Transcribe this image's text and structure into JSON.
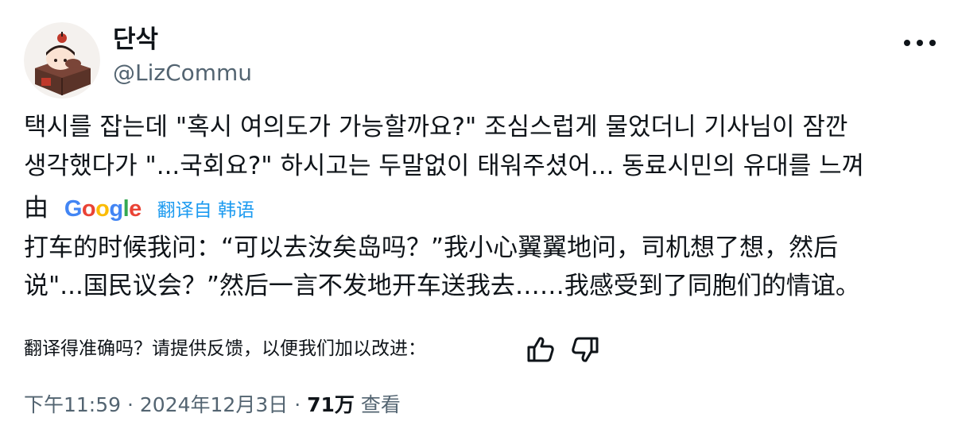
{
  "author": {
    "display_name": "단삭",
    "handle": "@LizCommu"
  },
  "tweet": {
    "text": "택시를 잡는데 \"혹시 여의도가 가능할까요?\" 조심스럽게 물었더니 기사님이 잠깐\n생각했다가 \"...국회요?\" 하시고는 두말없이 태워주셨어... 동료시민의 유대를 느껴",
    "text_tail": "由"
  },
  "translate": {
    "provider": "Google",
    "label": "翻译自 韩语",
    "text": "打车的时候我问：“可以去汝矣岛吗？”我小心翼翼地问，司机想了想，然后\n说\"...国民议会？”然后一言不发地开车送我去……我感受到了同胞们的情谊。"
  },
  "feedback": {
    "prompt": "翻译得准确吗？请提供反馈，以便我们加以改进：",
    "thumbs_up_icon": "thumbs-up-icon",
    "thumbs_down_icon": "thumbs-down-icon"
  },
  "meta": {
    "time": "下午11:59",
    "date": "2024年12月3日",
    "views_count": "71万",
    "views_label": "查看",
    "separator": "·"
  },
  "colors": {
    "text": "#0f1419",
    "secondary": "#536471",
    "link": "#1d9bf0"
  }
}
